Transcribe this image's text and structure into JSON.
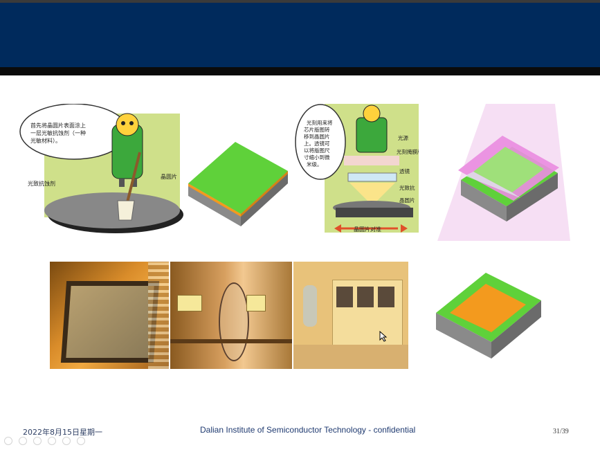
{
  "slide": {
    "footer_date": "2022年8月15日星期一",
    "footer_center": "Dalian Institute of Semiconductor Technology - confidential",
    "page_number": "31/39"
  },
  "cartoon1": {
    "bubble_lines": [
      "首先将晶圆片表面涂上",
      "一层光敏抗蚀剂（一种",
      "光敏材料）。"
    ],
    "label_resist": "光致抗蚀剂",
    "label_wafer": "晶圆片"
  },
  "cartoon2": {
    "bubble_lines": [
      "光刻用来将",
      "芯片版图转",
      "移到晶圆片",
      "上。透镜可",
      "以将版图尺",
      "寸缩小到微",
      "米级。"
    ],
    "label_source": "光源",
    "label_mask": "光刻掩膜版",
    "label_lens": "透镜",
    "label_resist": "光致抗",
    "label_wafer": "晶圆片",
    "label_align": "晶圆片对准"
  },
  "colors": {
    "header": "#002a5c",
    "green_layer": "#5fd13a",
    "orange_layer": "#f39a1e",
    "mask_pink": "#e98de0",
    "yellow_room": "#e8c27a"
  },
  "toolbar_icons": [
    "prev-icon",
    "play-icon",
    "pen-icon",
    "copy-icon",
    "zoom-icon",
    "more-icon"
  ]
}
